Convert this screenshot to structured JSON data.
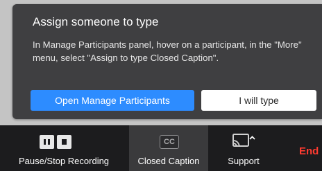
{
  "popup": {
    "title": "Assign someone to type",
    "body": "In Manage Participants panel, hover on a participant, in the \"More\" menu, select \"Assign to type Closed Caption\".",
    "primary_button": "Open Manage Participants",
    "secondary_button": "I will type"
  },
  "toolbar": {
    "items": [
      {
        "label": "Pause/Stop Recording",
        "icon": "pause-stop-recording-icon"
      },
      {
        "label": "Closed Caption",
        "icon": "closed-caption-icon",
        "icon_text": "CC"
      },
      {
        "label": "Support",
        "icon": "screen-share-support-icon"
      }
    ],
    "end_label": "End"
  },
  "colors": {
    "popup_bg": "#3f3f41",
    "primary_blue": "#2d8cff",
    "toolbar_bg": "#1c1c1e",
    "end_red": "#ff3b30"
  }
}
